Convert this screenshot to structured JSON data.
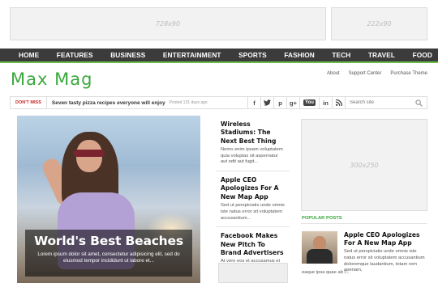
{
  "ads": {
    "top_left": "728x90",
    "top_right": "222x90",
    "sidebar": "300x250"
  },
  "nav": {
    "items": [
      "HOME",
      "FEATURES",
      "BUSINESS",
      "ENTERTAINMENT",
      "SPORTS",
      "FASHION",
      "TECH",
      "TRAVEL",
      "FOOD"
    ]
  },
  "brand": {
    "logo": "Max Mag",
    "accent_color": "#3aa83c"
  },
  "top_links": [
    "About",
    "Support Center",
    "Purchase Theme"
  ],
  "ticker": {
    "label": "DON'T MISS",
    "headline": "Seven tasty pizza recipes everyone will enjoy",
    "time": "Posted 131 days ago"
  },
  "social": [
    "f",
    "t",
    "p",
    "g+",
    "You",
    "in",
    "rss"
  ],
  "search": {
    "placeholder": "Search site"
  },
  "feature": {
    "title": "World's Best Beaches",
    "excerpt": "Lorem ipsum dolor sit amet, consectetur adipisicing elit, sed do eiusmod tempor incididunt ut labore et..."
  },
  "mid_articles": [
    {
      "title": "Wireless Stadiums: The Next Best Thing",
      "excerpt": "Nemo enim ipsam voluptatem quia voluptas sit aspernatur aut odit aut fugit..."
    },
    {
      "title": "Apple CEO Apologizes For A New Map App",
      "excerpt": "Sed ut perspiciatis unde omnis iste natus error sit voluptatem accusantium..."
    },
    {
      "title": "Facebook Makes New Pitch To Brand Advertisers",
      "excerpt": "At vero eos et accusamus et iusto odio dignissimos ducimus qui blanditiis..."
    }
  ],
  "popular": {
    "label": "POPULAR POSTS",
    "title": "Apple CEO Apologizes For A New Map App",
    "excerpt": "Sed ut perspiciatis unde omnis iste natus error sit voluptatem accusantium doloremque laudantium, totam rem aperiam,",
    "excerpt_tail": "eaque ipsa quae ab i..."
  }
}
